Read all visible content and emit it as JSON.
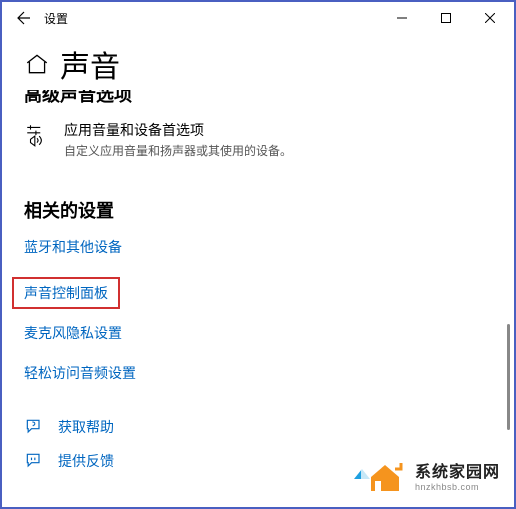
{
  "titlebar": {
    "title": "设置"
  },
  "page": {
    "heading": "声音",
    "advanced_cut": "高级声音选项"
  },
  "option": {
    "title": "应用音量和设备首选项",
    "desc": "自定义应用音量和扬声器或其使用的设备。"
  },
  "related": {
    "heading": "相关的设置",
    "links": {
      "bluetooth": "蓝牙和其他设备",
      "sound_panel": "声音控制面板",
      "mic_privacy": "麦克风隐私设置",
      "ease_audio": "轻松访问音频设置"
    }
  },
  "footer": {
    "help": "获取帮助",
    "feedback": "提供反馈"
  },
  "watermark": {
    "name": "系统家园网",
    "url": "hnzkhbsb.com"
  }
}
